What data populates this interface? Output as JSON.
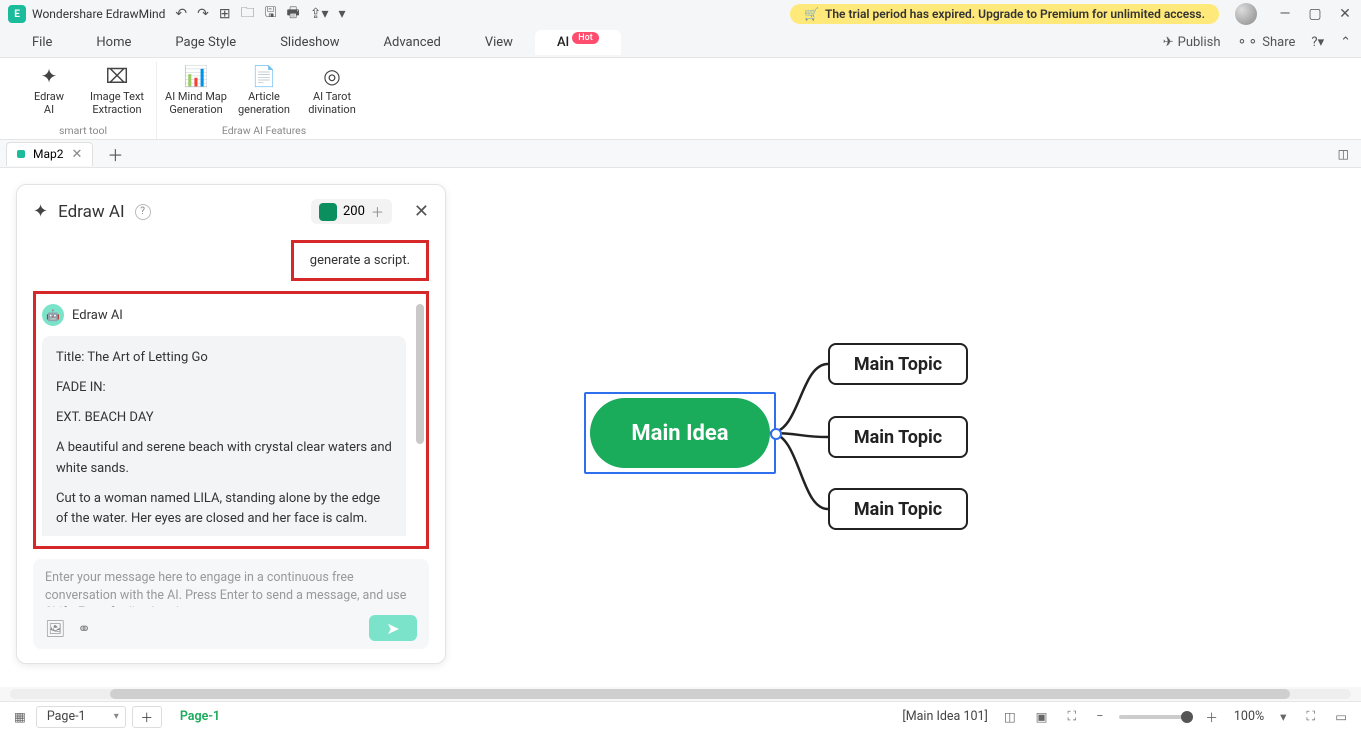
{
  "app": {
    "title": "Wondershare EdrawMind",
    "trial_message": "The trial period has expired. Upgrade to Premium for unlimited access."
  },
  "menu": {
    "items": [
      "File",
      "Home",
      "Page Style",
      "Slideshow",
      "Advanced",
      "View",
      "AI"
    ],
    "active": "AI",
    "hot_badge": "Hot",
    "publish": "Publish",
    "share": "Share"
  },
  "ribbon": {
    "group1_label": "smart tool",
    "group2_label": "Edraw AI Features",
    "btns": {
      "edraw_ai": "Edraw\nAI",
      "img_text": "Image Text\nExtraction",
      "mindmap_gen": "AI Mind Map\nGeneration",
      "article_gen": "Article\ngeneration",
      "tarot": "AI Tarot\ndivination"
    }
  },
  "doc": {
    "tab_name": "Map2"
  },
  "ai_panel": {
    "title": "Edraw AI",
    "credits": "200",
    "user_message": "generate a script.",
    "responder": "Edraw AI",
    "response": {
      "l1": "Title: The Art of Letting Go",
      "l2": "FADE IN:",
      "l3": "EXT. BEACH  DAY",
      "l4": "A beautiful and serene beach with crystal clear waters and white sands.",
      "l5": "Cut to a woman named LILA, standing alone by the edge of the water. Her eyes are closed and her face is calm."
    },
    "input_placeholder": "Enter your message here to engage in a continuous free conversation with the AI. Press Enter to send a message, and use Shift+Enter for line breaks"
  },
  "mindmap": {
    "main": "Main Idea",
    "topic1": "Main Topic",
    "topic2": "Main Topic",
    "topic3": "Main Topic"
  },
  "status": {
    "page_selector": "Page-1",
    "active_page": "Page-1",
    "selection_info": "[Main Idea 101]",
    "zoom": "100%"
  }
}
